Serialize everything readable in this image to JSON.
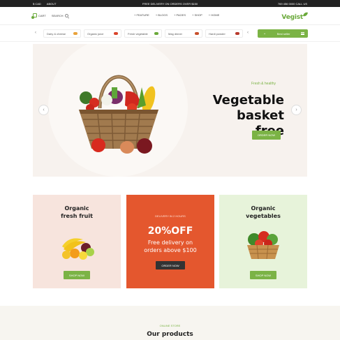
{
  "topbar": {
    "currency": "$ CAD",
    "about": "ABOUT",
    "promo": "FREE DELIVERY ON ORDERS OVER $150",
    "phone": "769 456 0000 CALL US"
  },
  "header": {
    "cart": "CART",
    "search": "SEARCH",
    "nav": [
      "+ FEATURE",
      "+ BLOGS",
      "+ PAGES",
      "+ SHOP",
      "+ HOME"
    ],
    "logo": "Vegist"
  },
  "categories": {
    "items": [
      {
        "label": "Dairy & cheese",
        "color": "#e9a23b"
      },
      {
        "label": "Organic juice",
        "color": "#d9442b"
      },
      {
        "label": "Fresh vegetable",
        "color": "#6aa93a"
      },
      {
        "label": "Mag dinner",
        "color": "#c8502c"
      },
      {
        "label": "Hardi powder",
        "color": "#b83a2c"
      }
    ],
    "bestseller": "Best seller"
  },
  "hero": {
    "subtitle": "Fresh & healthy",
    "title_line1": "Vegetable",
    "title_line2": "basket free",
    "button": "ORDER NOW"
  },
  "cards": {
    "fruit": {
      "title_line1": "Organic",
      "title_line2": "fresh fruit",
      "button": "SHOP NOW"
    },
    "delivery": {
      "subtitle": "DELIVERY IN 2 HOURS",
      "big": "20%OFF",
      "line1": "Free delivery on",
      "line2": "orders above $100",
      "button": "ORDER NOW"
    },
    "veg": {
      "title_line1": "Organic",
      "title_line2": "vegetables",
      "button": "SHOP NOW"
    }
  },
  "products": {
    "subtitle": "ONLINE STORE",
    "title": "Our products"
  },
  "colors": {
    "accent": "#7bb345",
    "promo_card": "#e4572e",
    "dark": "#222222"
  }
}
